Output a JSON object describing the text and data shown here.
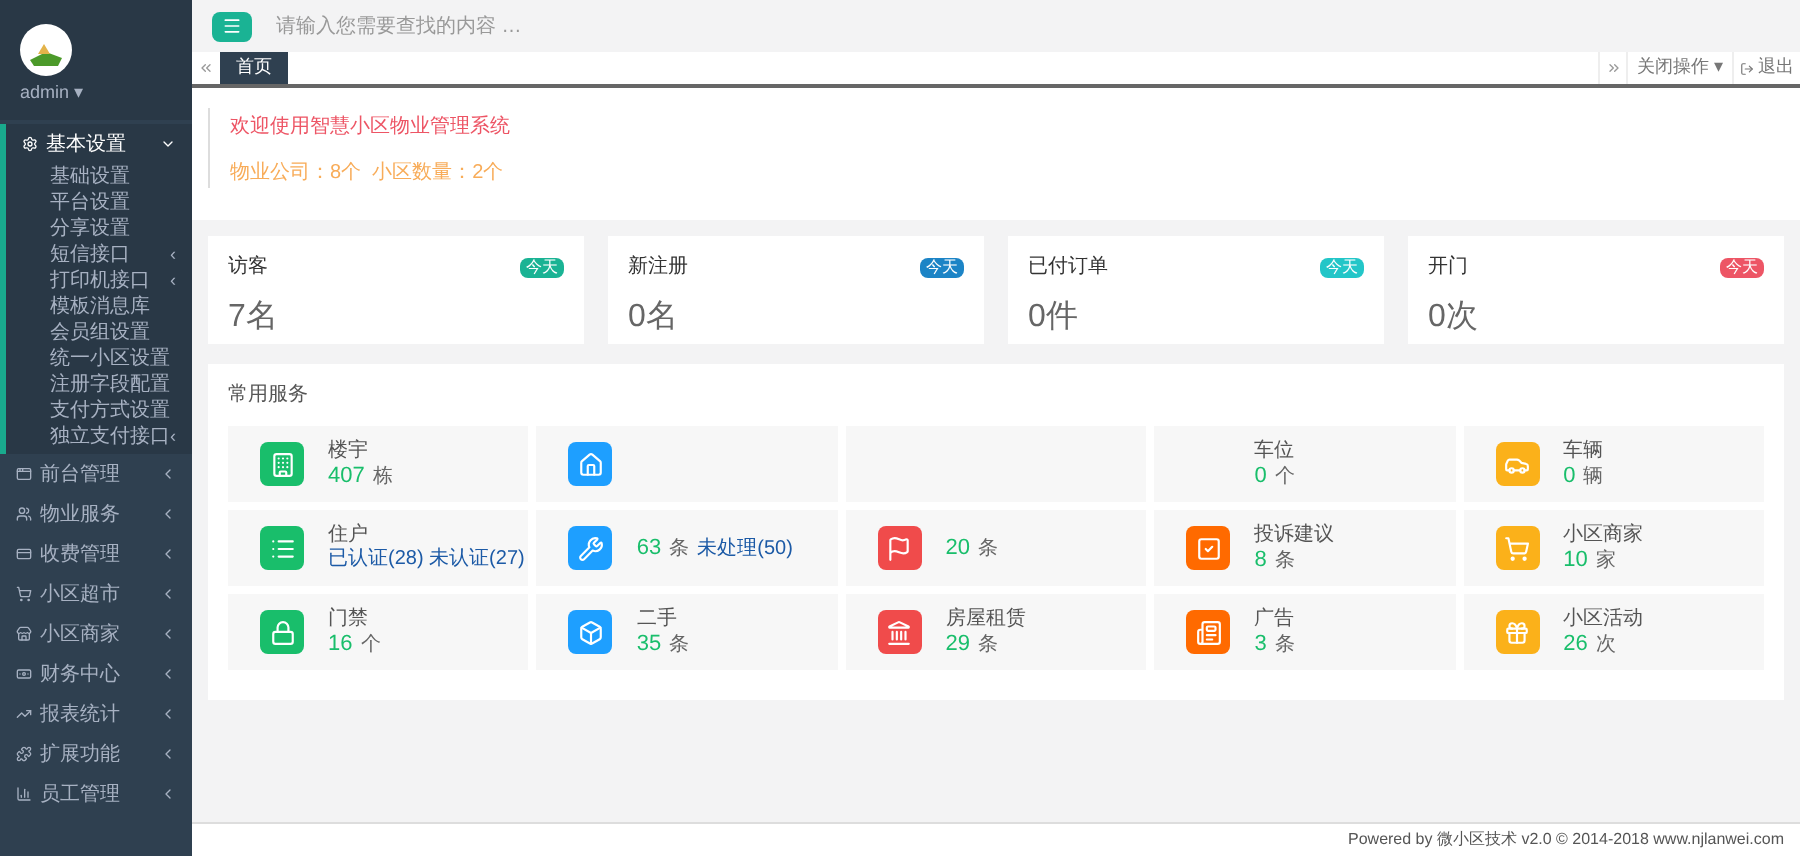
{
  "user": {
    "name": "admin ▾"
  },
  "sidebar": {
    "items": [
      {
        "label": "基本设置",
        "expanded": true,
        "children": [
          {
            "label": "基础设置"
          },
          {
            "label": "平台设置"
          },
          {
            "label": "分享设置"
          },
          {
            "label": "短信接口",
            "arrow": "‹"
          },
          {
            "label": "打印机接口",
            "arrow": "‹"
          },
          {
            "label": "模板消息库"
          },
          {
            "label": "会员组设置"
          },
          {
            "label": "统一小区设置"
          },
          {
            "label": "注册字段配置"
          },
          {
            "label": "支付方式设置"
          },
          {
            "label": "独立支付接口",
            "arrow": "‹"
          }
        ]
      },
      {
        "label": "前台管理",
        "expanded": false
      },
      {
        "label": "物业服务",
        "expanded": false
      },
      {
        "label": "收费管理",
        "expanded": false
      },
      {
        "label": "小区超市",
        "expanded": false
      },
      {
        "label": "小区商家",
        "expanded": false
      },
      {
        "label": "财务中心",
        "expanded": false
      },
      {
        "label": "报表统计",
        "expanded": false
      },
      {
        "label": "扩展功能",
        "expanded": false
      },
      {
        "label": "员工管理",
        "expanded": false
      }
    ]
  },
  "search": {
    "placeholder": "请输入您需要查找的内容 …"
  },
  "tabs": [
    {
      "label": "首页",
      "selected": true
    }
  ],
  "tab_actions": [
    "关闭操作 ▾",
    "退出"
  ],
  "welcome": {
    "title": "欢迎使用智慧小区物业管理系统",
    "info": "物业公司：8个  小区数量：2个"
  },
  "stats": [
    {
      "label": "访客",
      "badge": "今天",
      "color": "#1ab394",
      "value": "7名"
    },
    {
      "label": "新注册",
      "badge": "今天",
      "color": "#1c84c6",
      "value": "0名"
    },
    {
      "label": "已付订单",
      "badge": "今天",
      "color": "#23c6c8",
      "value": "0件"
    },
    {
      "label": "开门",
      "badge": "今天",
      "color": "#ed5565",
      "value": "0次"
    }
  ],
  "services": {
    "title": "常用服务",
    "tiles": [
      {
        "kind": "tile",
        "color": "#19be6b",
        "label": "楼宇",
        "value": "407",
        "unit": "栋"
      },
      {
        "kind": "tile",
        "color": "#1e9fff"
      },
      {
        "kind": "blank"
      },
      {
        "kind": "tile",
        "label": "车位",
        "value": "0",
        "unit": "个"
      },
      {
        "kind": "tile",
        "color": "#fbb11a",
        "label": "车辆",
        "value": "0",
        "unit": "辆"
      },
      {
        "kind": "tile",
        "color": "#19be6b",
        "label": "住户",
        "note": "已认证(28) 未认证(27)"
      },
      {
        "kind": "tile",
        "color": "#1e9fff",
        "value": "63",
        "unit": "条",
        "note": "未处理(50)"
      },
      {
        "kind": "tile",
        "color": "#f04b4b",
        "value": "20",
        "unit": "条"
      },
      {
        "kind": "tile",
        "color": "#ff6a00",
        "label": "投诉建议",
        "value": "8",
        "unit": "条"
      },
      {
        "kind": "tile",
        "color": "#fbb11a",
        "label": "小区商家",
        "value": "10",
        "unit": "家"
      },
      {
        "kind": "tile",
        "color": "#19be6b",
        "label": "门禁",
        "value": "16",
        "unit": "个"
      },
      {
        "kind": "tile",
        "color": "#1e9fff",
        "label": "二手",
        "value": "35",
        "unit": "条"
      },
      {
        "kind": "tile",
        "color": "#f04b4b",
        "label": "房屋租赁",
        "value": "29",
        "unit": "条"
      },
      {
        "kind": "tile",
        "color": "#ff6a00",
        "label": "广告",
        "value": "3",
        "unit": "条"
      },
      {
        "kind": "tile",
        "color": "#fbb11a",
        "label": "小区活动",
        "value": "26",
        "unit": "次"
      }
    ]
  },
  "footer": "Powered by 微小区技术 v2.0 © 2014-2018 www.njlanwei.com"
}
